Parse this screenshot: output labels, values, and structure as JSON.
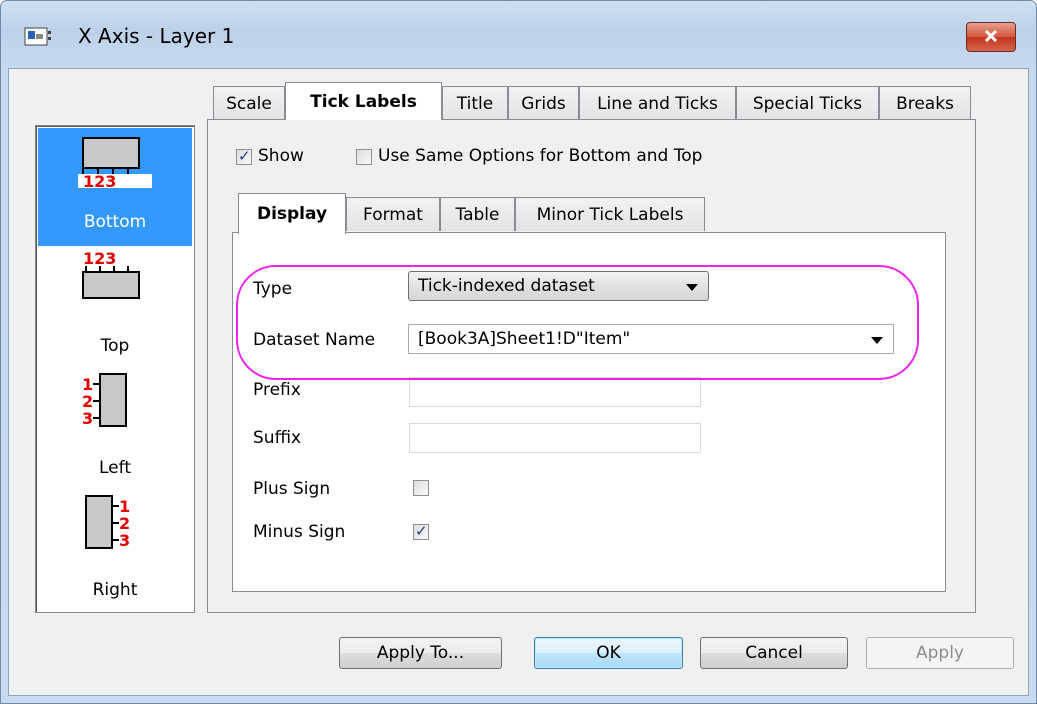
{
  "window": {
    "title": "X Axis - Layer 1",
    "close_icon": "close-icon"
  },
  "sidebar": {
    "items": [
      {
        "label": "Bottom",
        "icon": "bottom-axis-icon",
        "digits": "123"
      },
      {
        "label": "Top",
        "icon": "top-axis-icon",
        "digits": "123"
      },
      {
        "label": "Left",
        "icon": "left-axis-icon",
        "digits": "123"
      },
      {
        "label": "Right",
        "icon": "right-axis-icon",
        "digits": "123"
      }
    ],
    "selected": "Bottom"
  },
  "tabs": [
    "Scale",
    "Tick Labels",
    "Title",
    "Grids",
    "Line and Ticks",
    "Special Ticks",
    "Breaks"
  ],
  "active_tab": "Tick Labels",
  "options": {
    "show_label": "Show",
    "show_checked": true,
    "same_options_label": "Use Same Options for Bottom and Top",
    "same_options_checked": false
  },
  "subtabs": [
    "Display",
    "Format",
    "Table",
    "Minor Tick Labels"
  ],
  "active_subtab": "Display",
  "form": {
    "type_label": "Type",
    "type_value": "Tick-indexed dataset",
    "dataset_label": "Dataset Name",
    "dataset_value": "[Book3A]Sheet1!D\"Item\"",
    "prefix_label": "Prefix",
    "prefix_value": "",
    "suffix_label": "Suffix",
    "suffix_value": "",
    "plus_label": "Plus Sign",
    "plus_checked": false,
    "minus_label": "Minus Sign",
    "minus_checked": true
  },
  "buttons": {
    "apply_to": "Apply To...",
    "ok": "OK",
    "cancel": "Cancel",
    "apply": "Apply"
  },
  "colors": {
    "selection": "#3399ff",
    "highlight": "#ee22ee",
    "digit_red": "#e00000"
  }
}
